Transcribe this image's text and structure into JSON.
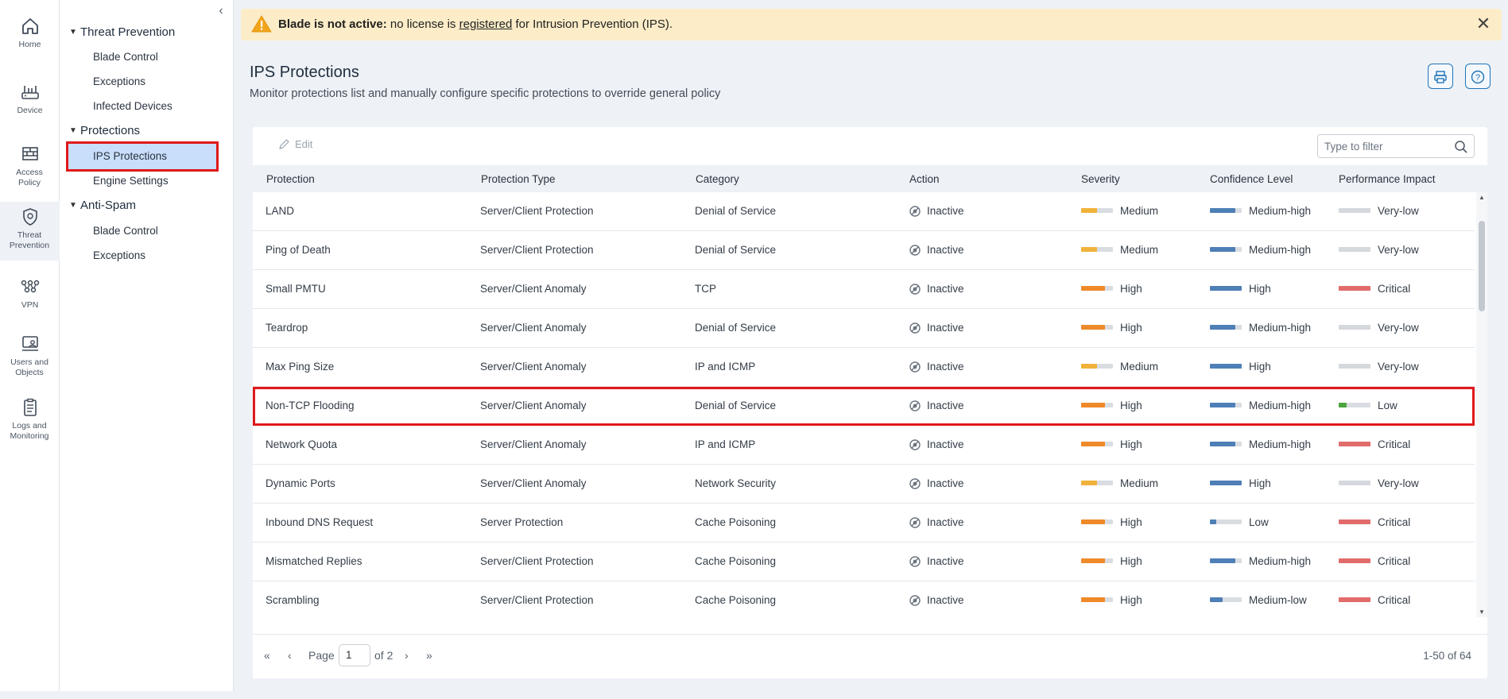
{
  "rail": [
    {
      "label": "Home",
      "icon": "home-icon"
    },
    {
      "label": "Device",
      "icon": "device-icon"
    },
    {
      "label": "Access Policy",
      "icon": "access-policy-icon"
    },
    {
      "label": "Threat Prevention",
      "icon": "threat-prevention-icon",
      "active": true
    },
    {
      "label": "VPN",
      "icon": "vpn-icon"
    },
    {
      "label": "Users and Objects",
      "icon": "users-objects-icon"
    },
    {
      "label": "Logs and Monitoring",
      "icon": "logs-icon"
    }
  ],
  "tree": {
    "groups": [
      {
        "label": "Threat Prevention",
        "items": [
          "Blade Control",
          "Exceptions",
          "Infected Devices"
        ]
      },
      {
        "label": "Protections",
        "items": [
          "IPS Protections",
          "Engine Settings"
        ]
      },
      {
        "label": "Anti-Spam",
        "items": [
          "Blade Control",
          "Exceptions"
        ]
      }
    ],
    "selected": "IPS Protections"
  },
  "banner": {
    "bold": "Blade is not active:",
    "text_before": " no license is ",
    "link": "registered",
    "text_after": " for Intrusion Prevention (IPS).",
    "icon": "warning-icon",
    "color": "#fcecc7"
  },
  "page": {
    "title": "IPS Protections",
    "subtitle": "Monitor protections list and manually configure specific protections to override general policy"
  },
  "toolbar": {
    "edit_label": "Edit",
    "filter_placeholder": "Type to filter"
  },
  "columns": [
    "Protection",
    "Protection Type",
    "Category",
    "Action",
    "Severity",
    "Confidence Level",
    "Performance Impact"
  ],
  "rows": [
    {
      "protection": "LAND",
      "type": "Server/Client Protection",
      "category": "Denial of Service",
      "action": "Inactive",
      "severity": "Medium",
      "confidence": "Medium-high",
      "impact": "Very-low"
    },
    {
      "protection": "Ping of Death",
      "type": "Server/Client Protection",
      "category": "Denial of Service",
      "action": "Inactive",
      "severity": "Medium",
      "confidence": "Medium-high",
      "impact": "Very-low"
    },
    {
      "protection": "Small PMTU",
      "type": "Server/Client Anomaly",
      "category": "TCP",
      "action": "Inactive",
      "severity": "High",
      "confidence": "High",
      "impact": "Critical"
    },
    {
      "protection": "Teardrop",
      "type": "Server/Client Anomaly",
      "category": "Denial of Service",
      "action": "Inactive",
      "severity": "High",
      "confidence": "Medium-high",
      "impact": "Very-low"
    },
    {
      "protection": "Max Ping Size",
      "type": "Server/Client Anomaly",
      "category": "IP and ICMP",
      "action": "Inactive",
      "severity": "Medium",
      "confidence": "High",
      "impact": "Very-low"
    },
    {
      "protection": "Non-TCP Flooding",
      "type": "Server/Client Anomaly",
      "category": "Denial of Service",
      "action": "Inactive",
      "severity": "High",
      "confidence": "Medium-high",
      "impact": "Low",
      "highlighted": true
    },
    {
      "protection": "Network Quota",
      "type": "Server/Client Anomaly",
      "category": "IP and ICMP",
      "action": "Inactive",
      "severity": "High",
      "confidence": "Medium-high",
      "impact": "Critical"
    },
    {
      "protection": "Dynamic Ports",
      "type": "Server/Client Anomaly",
      "category": "Network Security",
      "action": "Inactive",
      "severity": "Medium",
      "confidence": "High",
      "impact": "Very-low"
    },
    {
      "protection": "Inbound DNS Request",
      "type": "Server Protection",
      "category": "Cache Poisoning",
      "action": "Inactive",
      "severity": "High",
      "confidence": "Low",
      "impact": "Critical"
    },
    {
      "protection": "Mismatched Replies",
      "type": "Server/Client Protection",
      "category": "Cache Poisoning",
      "action": "Inactive",
      "severity": "High",
      "confidence": "Medium-high",
      "impact": "Critical"
    },
    {
      "protection": "Scrambling",
      "type": "Server/Client Protection",
      "category": "Cache Poisoning",
      "action": "Inactive",
      "severity": "High",
      "confidence": "Medium-low",
      "impact": "Critical"
    }
  ],
  "levels": {
    "severity": {
      "Medium": {
        "fill": 0.5,
        "color": "#f0b23a"
      },
      "High": {
        "fill": 0.75,
        "color": "#ef8a2a"
      }
    },
    "confidence": {
      "Low": {
        "fill": 0.2,
        "color": "#4e7fb6"
      },
      "Medium-low": {
        "fill": 0.4,
        "color": "#4e7fb6"
      },
      "Medium-high": {
        "fill": 0.8,
        "color": "#4e7fb6"
      },
      "High": {
        "fill": 1.0,
        "color": "#4e7fb6"
      }
    },
    "impact": {
      "Very-low": {
        "fill": 1.0,
        "color": "#d5d8dc"
      },
      "Low": {
        "fill": 0.25,
        "color": "#4aa63c"
      },
      "Critical": {
        "fill": 1.0,
        "color": "#e26b6b"
      }
    }
  },
  "pager": {
    "page_label": "Page",
    "page_value": "1",
    "of_label": "of 2",
    "count": "1-50 of 64"
  }
}
